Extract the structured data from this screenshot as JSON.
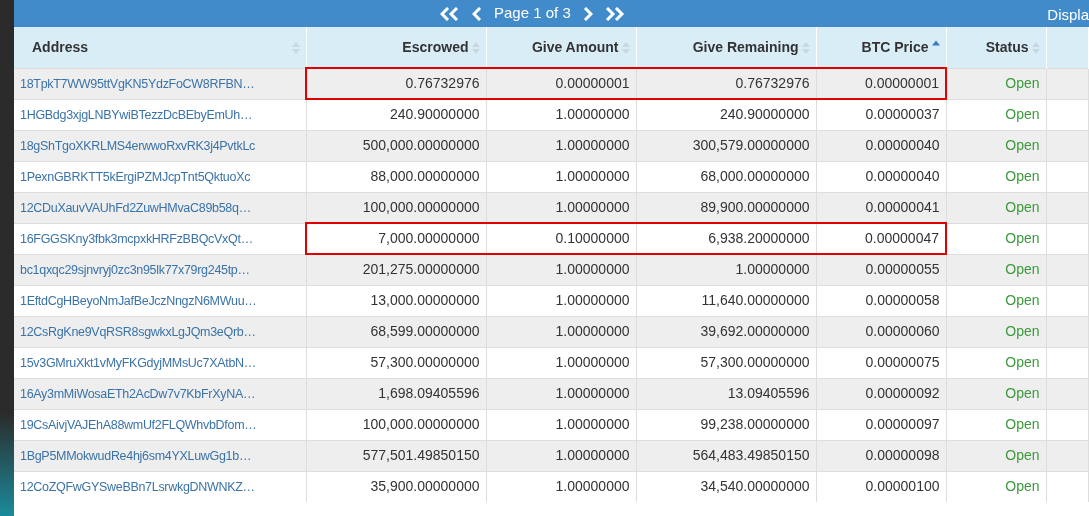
{
  "pager": {
    "page_label": "Page 1 of 3",
    "display_label": "Displa"
  },
  "table": {
    "columns": [
      {
        "label": "Address",
        "sorted": false
      },
      {
        "label": "Escrowed",
        "sorted": false
      },
      {
        "label": "Give Amount",
        "sorted": false
      },
      {
        "label": "Give Remaining",
        "sorted": false
      },
      {
        "label": "BTC Price",
        "sorted": true
      },
      {
        "label": "Status",
        "sorted": false
      }
    ],
    "rows": [
      {
        "address": "18TpkT7WW95ttVgKN5YdzFoCW8RFBN…",
        "escrowed": "0.76732976",
        "give_amount": "0.00000001",
        "give_remaining": "0.76732976",
        "btc_price": "0.00000001",
        "status": "Open",
        "highlighted": true
      },
      {
        "address": "1HGBdg3xjgLNBYwiBTezzDcBEbyEmUh…",
        "escrowed": "240.90000000",
        "give_amount": "1.00000000",
        "give_remaining": "240.90000000",
        "btc_price": "0.00000037",
        "status": "Open",
        "highlighted": false
      },
      {
        "address": "18gShTgoXKRLMS4erwwoRxvRK3j4PvtkLc",
        "escrowed": "500,000.00000000",
        "give_amount": "1.00000000",
        "give_remaining": "300,579.00000000",
        "btc_price": "0.00000040",
        "status": "Open",
        "highlighted": false
      },
      {
        "address": "1PexnGBRKTT5kErgiPZMJcpTnt5QktuoXc",
        "escrowed": "88,000.00000000",
        "give_amount": "1.00000000",
        "give_remaining": "68,000.00000000",
        "btc_price": "0.00000040",
        "status": "Open",
        "highlighted": false
      },
      {
        "address": "12CDuXauvVAUhFd2ZuwHMvaC89b58q…",
        "escrowed": "100,000.00000000",
        "give_amount": "1.00000000",
        "give_remaining": "89,900.00000000",
        "btc_price": "0.00000041",
        "status": "Open",
        "highlighted": false
      },
      {
        "address": "16FGGSKny3fbk3mcpxkHRFzBBQcVxQt…",
        "escrowed": "7,000.00000000",
        "give_amount": "0.10000000",
        "give_remaining": "6,938.20000000",
        "btc_price": "0.00000047",
        "status": "Open",
        "highlighted": true
      },
      {
        "address": "bc1qxqc29sjnvryj0zc3n95lk77x79rg245tp…",
        "escrowed": "201,275.00000000",
        "give_amount": "1.00000000",
        "give_remaining": "1.00000000",
        "btc_price": "0.00000055",
        "status": "Open",
        "highlighted": false
      },
      {
        "address": "1EftdCgHBeyoNmJafBeJczNngzN6MWuu…",
        "escrowed": "13,000.00000000",
        "give_amount": "1.00000000",
        "give_remaining": "11,640.00000000",
        "btc_price": "0.00000058",
        "status": "Open",
        "highlighted": false
      },
      {
        "address": "12CsRgKne9VqRSR8sgwkxLgJQm3eQrb…",
        "escrowed": "68,599.00000000",
        "give_amount": "1.00000000",
        "give_remaining": "39,692.00000000",
        "btc_price": "0.00000060",
        "status": "Open",
        "highlighted": false
      },
      {
        "address": "15v3GMruXkt1vMyFKGdyjMMsUc7XAtbN…",
        "escrowed": "57,300.00000000",
        "give_amount": "1.00000000",
        "give_remaining": "57,300.00000000",
        "btc_price": "0.00000075",
        "status": "Open",
        "highlighted": false
      },
      {
        "address": "16Ay3mMiWosaETh2AcDw7v7KbFrXyNA…",
        "escrowed": "1,698.09405596",
        "give_amount": "1.00000000",
        "give_remaining": "13.09405596",
        "btc_price": "0.00000092",
        "status": "Open",
        "highlighted": false
      },
      {
        "address": "19CsAivjVAJEhA88wmUf2FLQWhvbDfom…",
        "escrowed": "100,000.00000000",
        "give_amount": "1.00000000",
        "give_remaining": "99,238.00000000",
        "btc_price": "0.00000097",
        "status": "Open",
        "highlighted": false
      },
      {
        "address": "1BgP5MMokwudRe4hj6sm4YXLuwGg1b…",
        "escrowed": "577,501.49850150",
        "give_amount": "1.00000000",
        "give_remaining": "564,483.49850150",
        "btc_price": "0.00000098",
        "status": "Open",
        "highlighted": false
      },
      {
        "address": "12CoZQFwGYSweBBn7LsrwkgDNWNKZ…",
        "escrowed": "35,900.00000000",
        "give_amount": "1.00000000",
        "give_remaining": "34,540.00000000",
        "btc_price": "0.00000100",
        "status": "Open",
        "highlighted": false
      }
    ]
  }
}
